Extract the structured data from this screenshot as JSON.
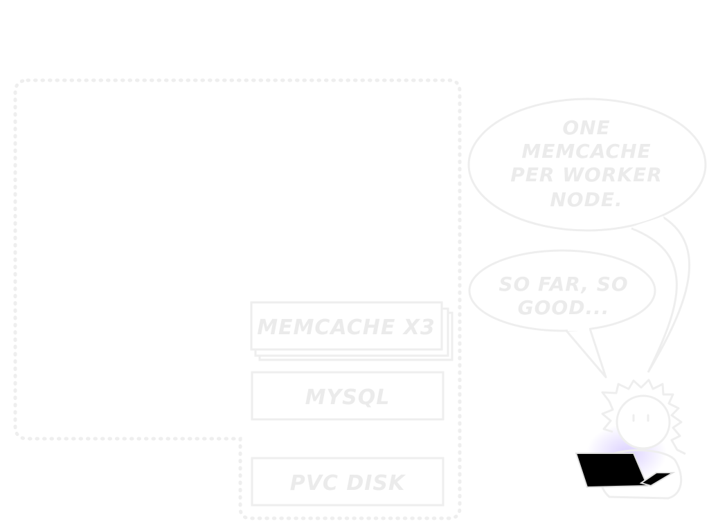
{
  "diagram": {
    "components": [
      {
        "id": "memcache",
        "label": "MEMCACHE X3"
      },
      {
        "id": "mysql",
        "label": "MYSQL"
      },
      {
        "id": "pvc",
        "label": "PVC DISK"
      }
    ]
  },
  "speech": {
    "bubble_top_lines": [
      "ONE",
      "MEMCACHE",
      "PER WORKER",
      "NODE."
    ],
    "bubble_bottom_lines": [
      "SO FAR, SO",
      "GOOD..."
    ]
  },
  "colors": {
    "faded": "#ebebeb",
    "laptop": "#000000",
    "glow": "#d8ccff"
  }
}
